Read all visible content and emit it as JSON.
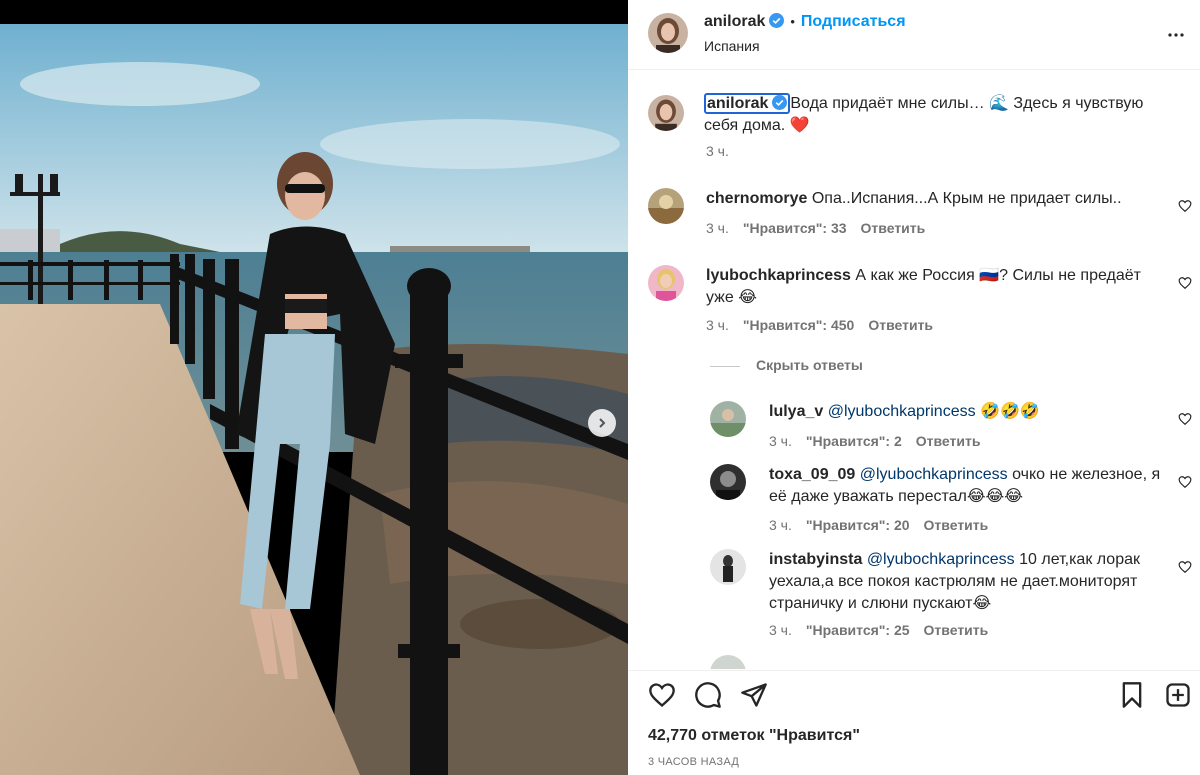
{
  "post": {
    "author": "anilorak",
    "follow_label": "Подписаться",
    "location": "Испания",
    "caption": "Вода придаёт мне силы… 🌊 Здесь я чувствую себя дома. ❤️",
    "caption_time": "3 ч."
  },
  "comments": [
    {
      "user": "chernomorye",
      "text": "Опа..Испания...А Крым не придает силы..",
      "time": "3 ч.",
      "likes": "\"Нравится\": 33",
      "reply": "Ответить"
    },
    {
      "user": "lyubochkaprincess",
      "text": "А как же Россия 🇷🇺? Силы не предаёт уже 😂",
      "time": "3 ч.",
      "likes": "\"Нравится\": 450",
      "reply": "Ответить"
    }
  ],
  "hide_replies": "Скрыть ответы",
  "replies": [
    {
      "user": "lulya_v",
      "mention": "@lyubochkaprincess",
      "text": " 🤣🤣🤣",
      "time": "3 ч.",
      "likes": "\"Нравится\": 2",
      "reply": "Ответить"
    },
    {
      "user": "toxa_09_09",
      "mention": "@lyubochkaprincess",
      "text": " очко не железное, я её даже уважать перестал😂😂😂",
      "time": "3 ч.",
      "likes": "\"Нравится\": 20",
      "reply": "Ответить"
    },
    {
      "user": "instabyinsta",
      "mention": "@lyubochkaprincess",
      "text": " 10 лет,как лорак уехала,а все покоя кастрюлям не дает.мониторят страничку и слюни пускают😂",
      "time": "3 ч.",
      "likes": "\"Нравится\": 25",
      "reply": "Ответить"
    }
  ],
  "footer": {
    "likes_count": "42,770 отметок \"Нравится\"",
    "time_ago": "3 ЧАСОВ НАЗАД"
  },
  "colors": {
    "accent": "#0095f6",
    "heart": "#ed4956",
    "verified": "#3897f0"
  },
  "icons": [
    "verified-icon",
    "more-icon",
    "heart-icon",
    "comment-icon",
    "share-icon",
    "bookmark-icon",
    "new-post-icon",
    "chevron-right-icon"
  ]
}
